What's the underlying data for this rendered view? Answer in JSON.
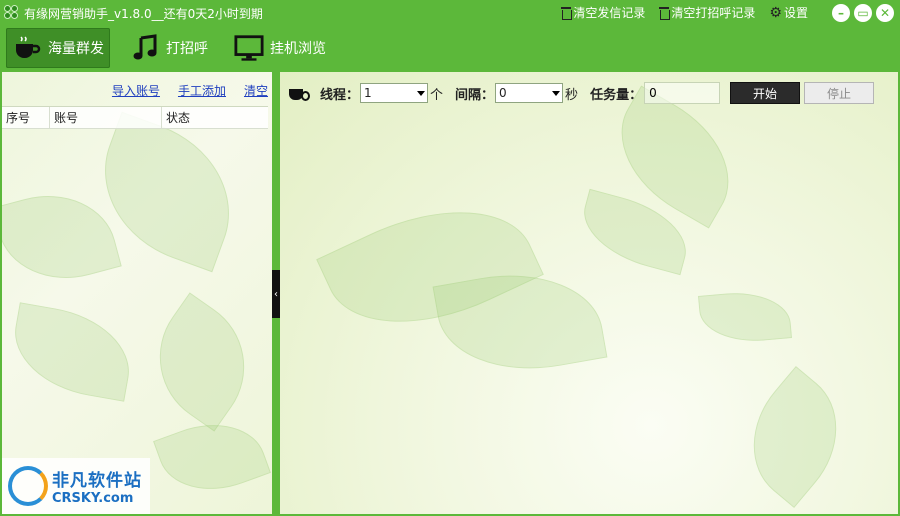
{
  "window": {
    "title": "有缘网营销助手_v1.8.0__还有0天2小时到期",
    "actions": [
      {
        "label": "清空发信记录",
        "icon": "trash-icon"
      },
      {
        "label": "清空打招呼记录",
        "icon": "trash-icon"
      },
      {
        "label": "设置",
        "icon": "gear-icon"
      }
    ],
    "buttons": {
      "minimize": "–",
      "restore": "▭",
      "close": "✕"
    }
  },
  "toolbar": {
    "items": [
      {
        "label": "海量群发",
        "icon": "coffee-cup-icon",
        "active": true
      },
      {
        "label": "打招呼",
        "icon": "music-note-icon",
        "active": false
      },
      {
        "label": "挂机浏览",
        "icon": "monitor-icon",
        "active": false
      }
    ]
  },
  "left_panel": {
    "links": [
      "导入账号",
      "手工添加",
      "清空"
    ],
    "table": {
      "columns": [
        "序号",
        "账号",
        "状态"
      ],
      "rows": []
    }
  },
  "splitter": {
    "glyph": "‹"
  },
  "controls": {
    "thread_label": "线程：",
    "thread_value": "1",
    "thread_unit": "个",
    "interval_label": "间隔：",
    "interval_value": "0",
    "interval_unit": "秒",
    "task_label": "任务量：",
    "task_value": "0",
    "start_label": "开始",
    "stop_label": "停止"
  },
  "watermark": {
    "cn": "非凡软件站",
    "en": "CRSKY.com"
  },
  "colors": {
    "accent": "#5cb83a",
    "active_tab": "#3f8f27",
    "link": "#1f3fbf"
  }
}
